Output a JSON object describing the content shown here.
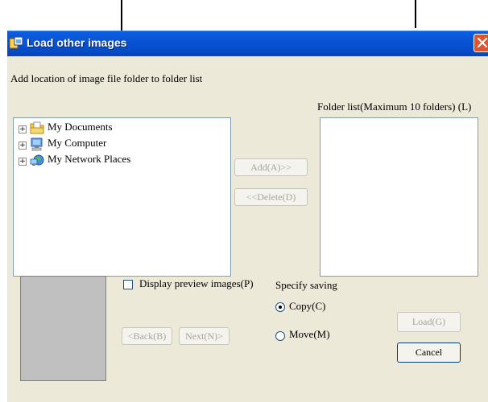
{
  "window": {
    "title": "Load other images",
    "instruction": "Add location of image file folder to folder list"
  },
  "tree": {
    "items": [
      {
        "label": "My Documents",
        "icon": "folder-documents-icon"
      },
      {
        "label": "My Computer",
        "icon": "computer-icon"
      },
      {
        "label": "My Network Places",
        "icon": "network-places-icon"
      }
    ]
  },
  "folder_list": {
    "label": "Folder list(Maximum 10 folders) (L)"
  },
  "buttons": {
    "add": "Add(A)>>",
    "delete": "<<Delete(D)",
    "back": "<Back(B)",
    "next": "Next(N)>",
    "load": "Load(G)",
    "cancel": "Cancel"
  },
  "preview": {
    "checkbox_label": "Display preview images(P)",
    "checked": false
  },
  "saving": {
    "label": "Specify saving",
    "options": [
      {
        "label": "Copy(C)",
        "selected": true
      },
      {
        "label": "Move(M)",
        "selected": false
      }
    ]
  },
  "colors": {
    "titlebar": "#0650cf",
    "dialog_bg": "#ece9d8",
    "close_button": "#e0522c",
    "field_border": "#7f9db9",
    "disabled_text": "#a7a59a"
  }
}
